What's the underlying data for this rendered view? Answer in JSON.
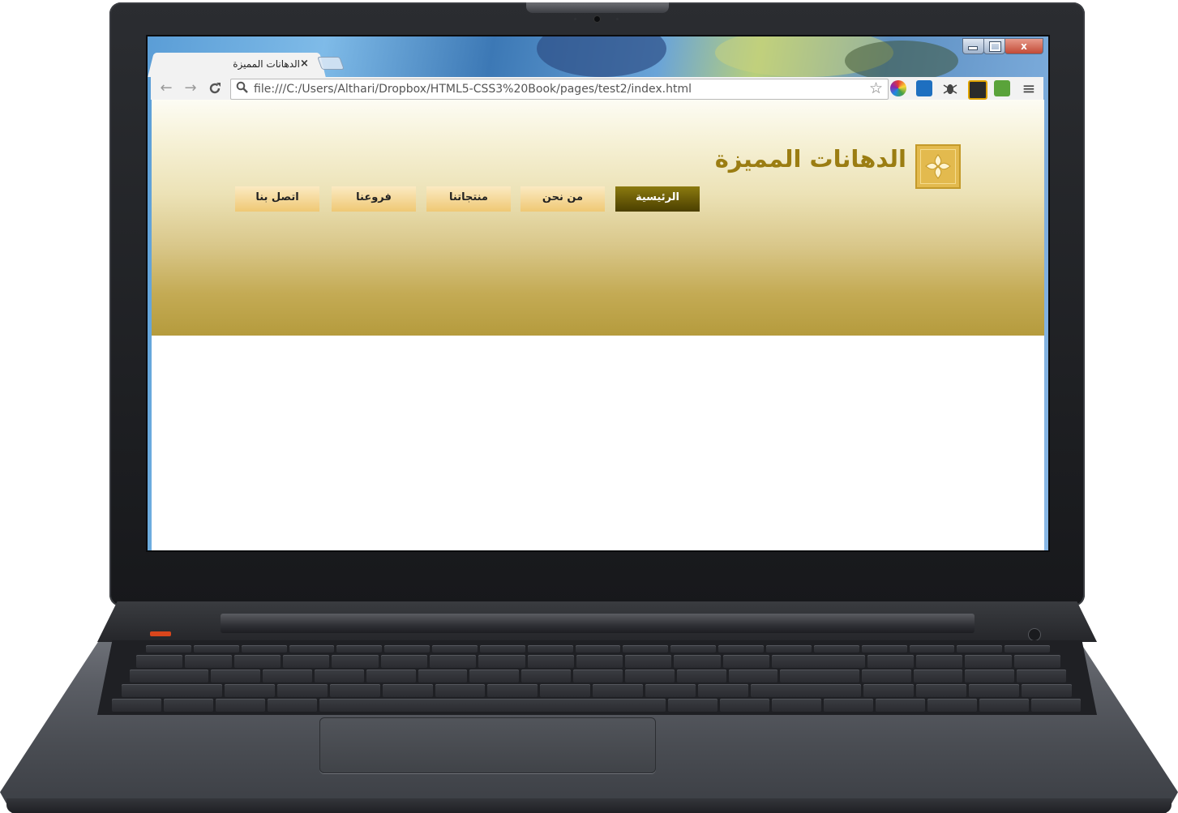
{
  "browser": {
    "tab": {
      "title": "الدهانات المميزة",
      "close": "×"
    },
    "window_controls": {
      "close": "x"
    },
    "toolbar": {
      "back": "←",
      "forward": "→",
      "reload": "C",
      "url": "file:///C:/Users/Althari/Dropbox/HTML5-CSS3%20Book/pages/test2/index.html",
      "menu": "≡"
    }
  },
  "site": {
    "brand": "الدهانات المميزة",
    "nav": {
      "home": "الرئيسية",
      "about": "من نحن",
      "products": "منتجاتنا",
      "branches": "فروعنا",
      "contact": "اتصل بنا"
    },
    "colors": {
      "brand_text": "#9b7d12",
      "nav_active": "#4b3f00",
      "nav_button": "#efc874",
      "header_bottom": "#b59b3d"
    }
  }
}
